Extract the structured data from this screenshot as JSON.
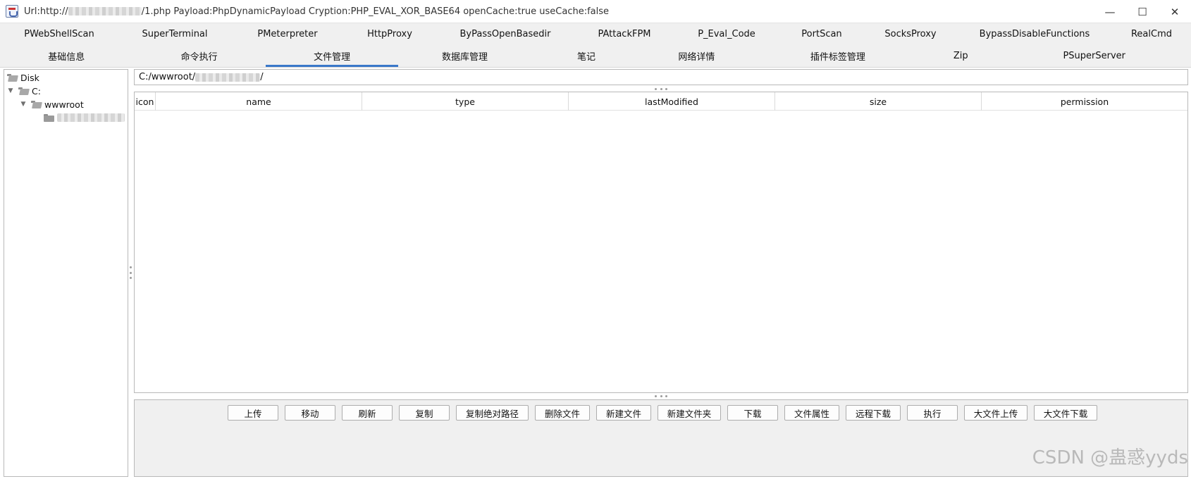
{
  "window": {
    "title_prefix": "Url:http://",
    "title_suffix": "/1.php Payload:PhpDynamicPayload Cryption:PHP_EVAL_XOR_BASE64 openCache:true useCache:false",
    "controls": {
      "minimize": "—",
      "maximize": "☐",
      "close": "✕"
    }
  },
  "tabs_row1": [
    "PWebShellScan",
    "SuperTerminal",
    "PMeterpreter",
    "HttpProxy",
    "ByPassOpenBasedir",
    "PAttackFPM",
    "P_Eval_Code",
    "PortScan",
    "SocksProxy",
    "BypassDisableFunctions",
    "RealCmd"
  ],
  "tabs_row2": [
    "基础信息",
    "命令执行",
    "文件管理",
    "数据库管理",
    "笔记",
    "网络详情",
    "插件标签管理",
    "Zip",
    "PSuperServer"
  ],
  "active_tab": "文件管理",
  "tree": {
    "root": "Disk",
    "drive": "C:",
    "folder": "wwwroot"
  },
  "path": {
    "prefix": "C:/wwwroot/",
    "suffix": "/"
  },
  "table": {
    "columns": [
      "icon",
      "name",
      "type",
      "lastModified",
      "size",
      "permission"
    ]
  },
  "actions": [
    "上传",
    "移动",
    "刷新",
    "复制",
    "复制绝对路径",
    "删除文件",
    "新建文件",
    "新建文件夹",
    "下载",
    "文件属性",
    "远程下载",
    "执行",
    "大文件上传",
    "大文件下载"
  ],
  "watermark": "CSDN @蛊惑yyds"
}
